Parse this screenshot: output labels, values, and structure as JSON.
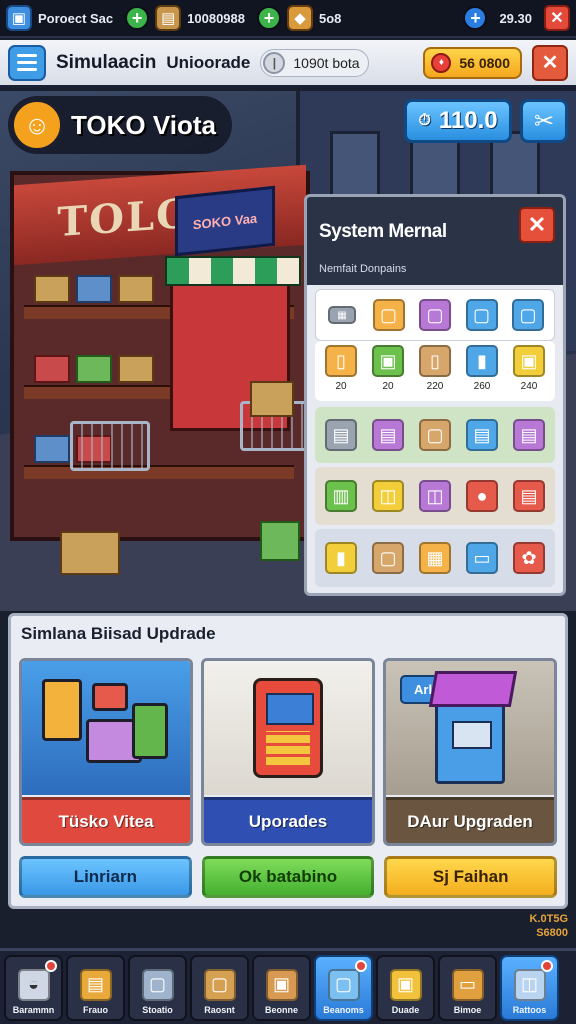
{
  "topbar": {
    "res1": {
      "icon": "shop-icon",
      "label": "Poroect Sac"
    },
    "res2": {
      "icon": "box-icon",
      "label": "10080988"
    },
    "res3": {
      "icon": "coin-bag-icon",
      "label": "5o8"
    },
    "res4": {
      "label": "29.30"
    }
  },
  "titlebar": {
    "title": "Simulaacin",
    "subtitle": "Unioorade",
    "toggle_text": "1090t bota",
    "gems": "56 0800"
  },
  "scene": {
    "shop_name": "TOKO Viota",
    "storefront_sign": "TOLO VI",
    "side_sign": "SOKO Vaa",
    "coin_value": "110.0"
  },
  "system_panel": {
    "title": "System Mernal",
    "subtitle": "Nemfait Donpains",
    "numbers": [
      "20",
      "20",
      "220",
      "260",
      "240"
    ],
    "colors": {
      "accent": "#e4503a",
      "header": "#2b3346"
    }
  },
  "upgrade_panel": {
    "title": "Simlana Biisad Updrade",
    "cards": [
      {
        "label": "Tüsko Vitea"
      },
      {
        "label": "Uporades"
      },
      {
        "label": "DAur Upgraden",
        "tag": "Arles"
      }
    ],
    "actions": [
      "Linriarn",
      "Ok batabino",
      "Sj Faihan"
    ]
  },
  "corner_info": {
    "line1": "K.0T5G",
    "line2": "S6800"
  },
  "bottomnav": [
    {
      "label": "Barammn",
      "icon": "cup-icon",
      "badge": true
    },
    {
      "label": "Frauo",
      "icon": "crate-icon",
      "badge": false
    },
    {
      "label": "Stoatio",
      "icon": "cube-icon",
      "badge": false
    },
    {
      "label": "Raosnt",
      "icon": "box-icon",
      "badge": false
    },
    {
      "label": "Beonne",
      "icon": "package-icon",
      "badge": false
    },
    {
      "label": "Beanoms",
      "icon": "blue-box-icon",
      "badge": true
    },
    {
      "label": "Duade",
      "icon": "gold-box-icon",
      "badge": false
    },
    {
      "label": "Bimoe",
      "icon": "frame-icon",
      "badge": false
    },
    {
      "label": "Rattoos",
      "icon": "bag-icon",
      "badge": true
    }
  ]
}
